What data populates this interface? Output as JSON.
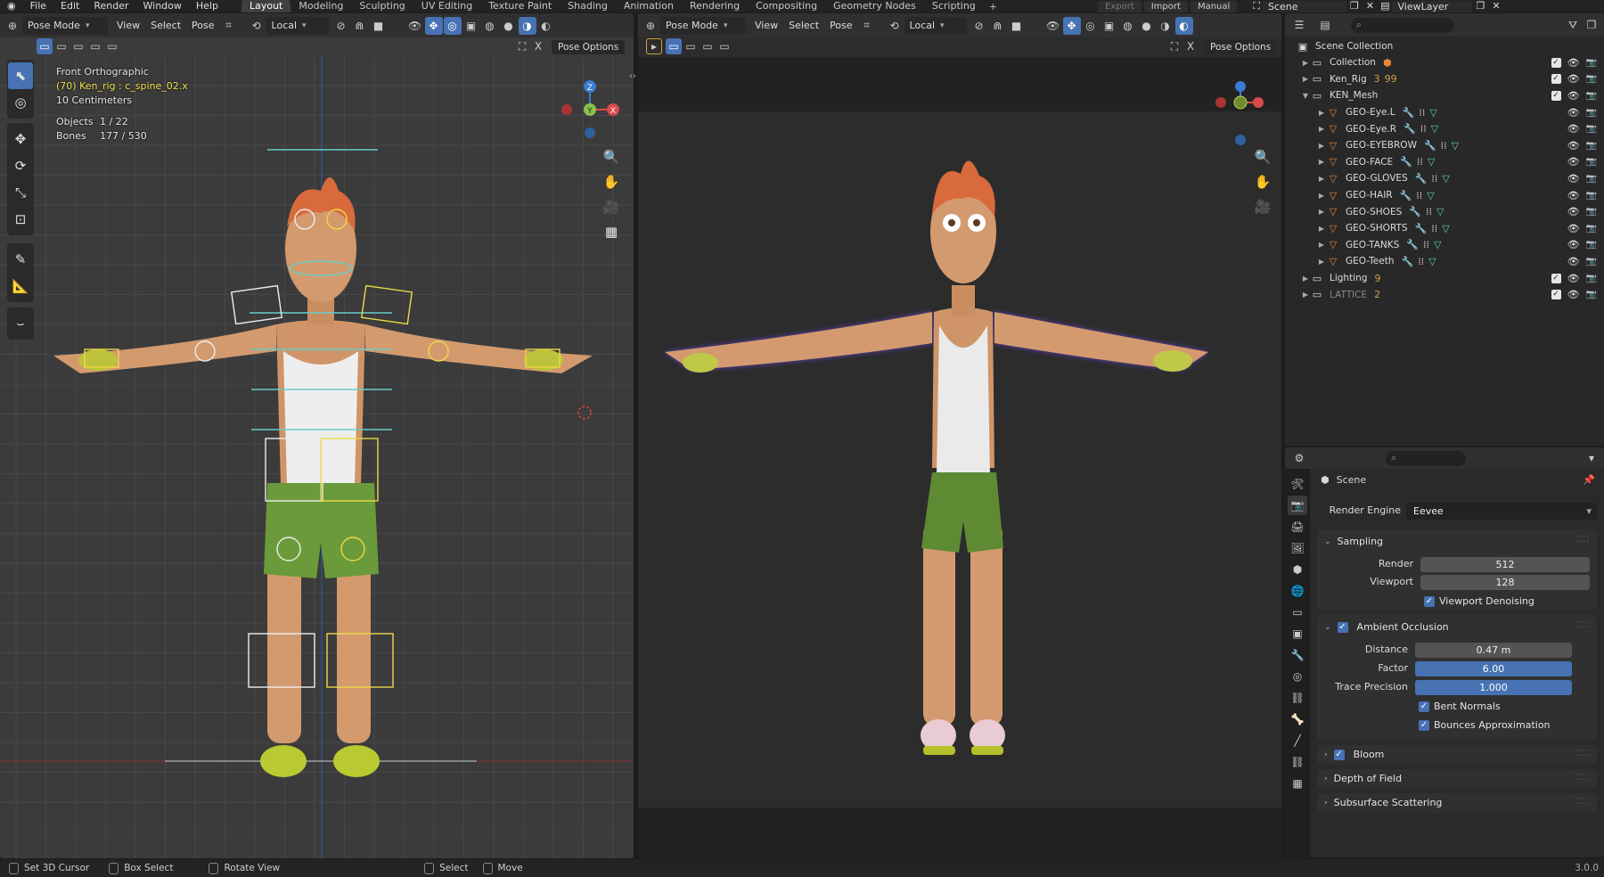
{
  "menu": {
    "items": [
      "File",
      "Edit",
      "Render",
      "Window",
      "Help"
    ]
  },
  "workspaces": {
    "tabs": [
      "Layout",
      "Modeling",
      "Sculpting",
      "UV Editing",
      "Texture Paint",
      "Shading",
      "Animation",
      "Rendering",
      "Compositing",
      "Geometry Nodes",
      "Scripting"
    ],
    "active": "Layout"
  },
  "topright": {
    "export": "Export",
    "import": "Import",
    "manual": "Manual",
    "scene": "Scene",
    "viewlayer": "ViewLayer"
  },
  "viewport_left": {
    "mode": "Pose Mode",
    "menus": [
      "View",
      "Select",
      "Pose"
    ],
    "orientation": "Local",
    "pose_options": "Pose Options",
    "overlay": {
      "view_name": "Front Orthographic",
      "active": "(70) Ken_rig : c_spine_02.x",
      "scale": "10 Centimeters",
      "objects_label": "Objects",
      "objects_value": "1 / 22",
      "bones_label": "Bones",
      "bones_value": "177 / 530"
    },
    "gizmo": {
      "x": "X",
      "y": "Y",
      "z": "Z"
    }
  },
  "viewport_right": {
    "mode": "Pose Mode",
    "menus": [
      "View",
      "Select",
      "Pose"
    ],
    "orientation": "Local",
    "pose_options": "Pose Options"
  },
  "outliner": {
    "root": "Scene Collection",
    "rows": [
      {
        "label": "Collection",
        "indent": 1,
        "expanded": false,
        "icon": "collection-icon",
        "extra": "scene-objects"
      },
      {
        "label": "Ken_Rig",
        "indent": 1,
        "expanded": false,
        "icon": "collection-icon",
        "extra": "rig",
        "badges": [
          "3",
          "99"
        ]
      },
      {
        "label": "KEN_Mesh",
        "indent": 1,
        "expanded": true,
        "icon": "collection-icon"
      },
      {
        "label": "GEO-Eye.L",
        "indent": 2,
        "icon": "mesh-icon"
      },
      {
        "label": "GEO-Eye.R",
        "indent": 2,
        "icon": "mesh-icon"
      },
      {
        "label": "GEO-EYEBROW",
        "indent": 2,
        "icon": "mesh-icon"
      },
      {
        "label": "GEO-FACE",
        "indent": 2,
        "icon": "mesh-icon"
      },
      {
        "label": "GEO-GLOVES",
        "indent": 2,
        "icon": "mesh-icon"
      },
      {
        "label": "GEO-HAIR",
        "indent": 2,
        "icon": "mesh-icon"
      },
      {
        "label": "GEO-SHOES",
        "indent": 2,
        "icon": "mesh-icon"
      },
      {
        "label": "GEO-SHORTS",
        "indent": 2,
        "icon": "mesh-icon"
      },
      {
        "label": "GEO-TANKS",
        "indent": 2,
        "icon": "mesh-icon"
      },
      {
        "label": "GEO-Teeth",
        "indent": 2,
        "icon": "mesh-icon"
      },
      {
        "label": "Lighting",
        "indent": 1,
        "expanded": false,
        "icon": "collection-icon",
        "badges": [
          "9"
        ]
      },
      {
        "label": "LATTICE",
        "indent": 1,
        "expanded": false,
        "icon": "collection-icon",
        "dim": true,
        "badges": [
          "2"
        ]
      }
    ]
  },
  "properties": {
    "context": "Scene",
    "render_engine_label": "Render Engine",
    "render_engine": "Eevee",
    "sampling": {
      "title": "Sampling",
      "render_label": "Render",
      "render": "512",
      "viewport_label": "Viewport",
      "viewport": "128",
      "denoise": "Viewport Denoising"
    },
    "ao": {
      "title": "Ambient Occlusion",
      "distance_label": "Distance",
      "distance": "0.47 m",
      "factor_label": "Factor",
      "factor": "6.00",
      "trace_label": "Trace Precision",
      "trace": "1.000",
      "bent": "Bent Normals",
      "bounces": "Bounces Approximation"
    },
    "bloom": "Bloom",
    "dof": "Depth of Field",
    "sss": "Subsurface Scattering"
  },
  "status": {
    "items": [
      "Set 3D Cursor",
      "Box Select",
      "Rotate View",
      "Select",
      "Move"
    ],
    "version": "3.0.0"
  }
}
